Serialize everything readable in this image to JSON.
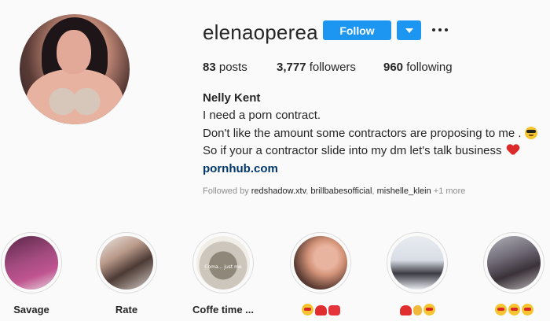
{
  "profile": {
    "username": "elenaoperea",
    "follow_label": "Follow",
    "posts_count": "83",
    "posts_label": "posts",
    "followers_count": "3,777",
    "followers_label": "followers",
    "following_count": "960",
    "following_label": "following"
  },
  "bio": {
    "name": "Nelly Kent",
    "line1": "I need a porn contract.",
    "line2": "Don't like the amount some contractors are proposing to me .",
    "line2_emoji": "smiling-face-with-sunglasses",
    "line3": "So if your a contractor slide into my dm let's talk business",
    "line3_emoji": "red-heart",
    "link": "pornhub.com"
  },
  "followed_by": {
    "prefix": "Followed by",
    "users": [
      "redshadow.xtv",
      "brillbabesofficial",
      "mishelle_klein"
    ],
    "separator": ", ",
    "more": "+1 more"
  },
  "highlights": [
    {
      "label": "Savage"
    },
    {
      "label": "Rate"
    },
    {
      "label": "Coffe time ...",
      "thumb_text": "Coma... just me"
    },
    {
      "label": "",
      "emojis": [
        "face",
        "heart",
        "red"
      ]
    },
    {
      "label": "",
      "emojis": [
        "heart",
        "ok",
        "face"
      ]
    },
    {
      "label": "",
      "emojis": [
        "face",
        "face",
        "face"
      ]
    }
  ],
  "colors": {
    "follow_button": "#1d96f2",
    "link": "#00376b",
    "background": "#fafafa"
  }
}
